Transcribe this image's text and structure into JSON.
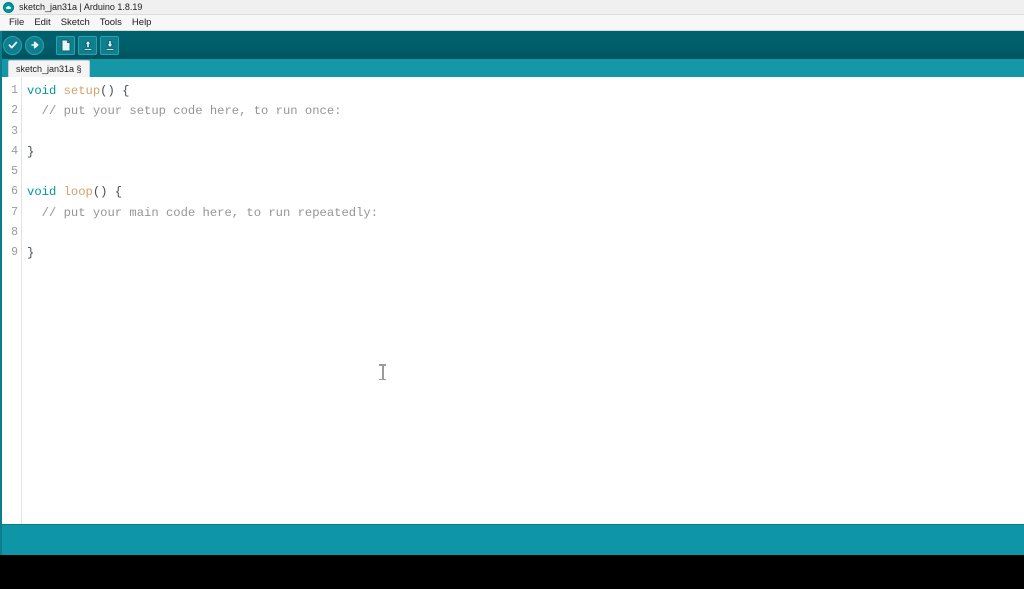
{
  "window": {
    "title": "sketch_jan31a | Arduino 1.8.19",
    "logo_icon": "arduino-logo-icon"
  },
  "menubar": {
    "items": [
      {
        "label": "File"
      },
      {
        "label": "Edit"
      },
      {
        "label": "Sketch"
      },
      {
        "label": "Tools"
      },
      {
        "label": "Help"
      }
    ]
  },
  "toolbar": {
    "buttons": [
      {
        "name": "verify-button",
        "icon": "checkmark-icon",
        "tooltip": "Verify"
      },
      {
        "name": "upload-button",
        "icon": "arrow-right-icon",
        "tooltip": "Upload"
      },
      {
        "name": "new-button",
        "icon": "new-file-icon",
        "tooltip": "New"
      },
      {
        "name": "open-button",
        "icon": "arrow-up-icon",
        "tooltip": "Open"
      },
      {
        "name": "save-button",
        "icon": "arrow-down-icon",
        "tooltip": "Save"
      }
    ]
  },
  "tabs": [
    {
      "label": "sketch_jan31a §",
      "active": true
    }
  ],
  "editor": {
    "line_numbers": [
      "1",
      "2",
      "3",
      "4",
      "5",
      "6",
      "7",
      "8",
      "9"
    ],
    "lines": [
      {
        "n": "1",
        "tokens": [
          {
            "t": "void",
            "c": "tok-kw"
          },
          {
            "t": " ",
            "c": "tok-punct"
          },
          {
            "t": "setup",
            "c": "tok-fn"
          },
          {
            "t": "() {",
            "c": "tok-punct"
          }
        ]
      },
      {
        "n": "2",
        "tokens": [
          {
            "t": "  // put your setup code here, to run once:",
            "c": "tok-comment"
          }
        ]
      },
      {
        "n": "3",
        "tokens": [
          {
            "t": "",
            "c": "tok-punct"
          }
        ]
      },
      {
        "n": "4",
        "tokens": [
          {
            "t": "}",
            "c": "tok-punct"
          }
        ]
      },
      {
        "n": "5",
        "tokens": [
          {
            "t": "",
            "c": "tok-punct"
          }
        ]
      },
      {
        "n": "6",
        "tokens": [
          {
            "t": "void",
            "c": "tok-kw"
          },
          {
            "t": " ",
            "c": "tok-punct"
          },
          {
            "t": "loop",
            "c": "tok-fn"
          },
          {
            "t": "() {",
            "c": "tok-punct"
          }
        ]
      },
      {
        "n": "7",
        "tokens": [
          {
            "t": "  // put your main code here, to run repeatedly:",
            "c": "tok-comment"
          }
        ]
      },
      {
        "n": "8",
        "tokens": [
          {
            "t": "",
            "c": "tok-punct"
          }
        ]
      },
      {
        "n": "9",
        "tokens": [
          {
            "t": "}",
            "c": "tok-punct"
          }
        ]
      }
    ],
    "cursor_icon": "text-ibeam-cursor"
  },
  "statusbar": {
    "message": "",
    "board_info": ""
  },
  "colors": {
    "toolbar_bg": "#005e6b",
    "tabstrip_bg": "#1497a6",
    "statusbar_bg": "#0f96a6",
    "keyword": "#00979c",
    "function": "#d3a06a",
    "comment": "#959595",
    "editor_bg": "#ffffff"
  }
}
